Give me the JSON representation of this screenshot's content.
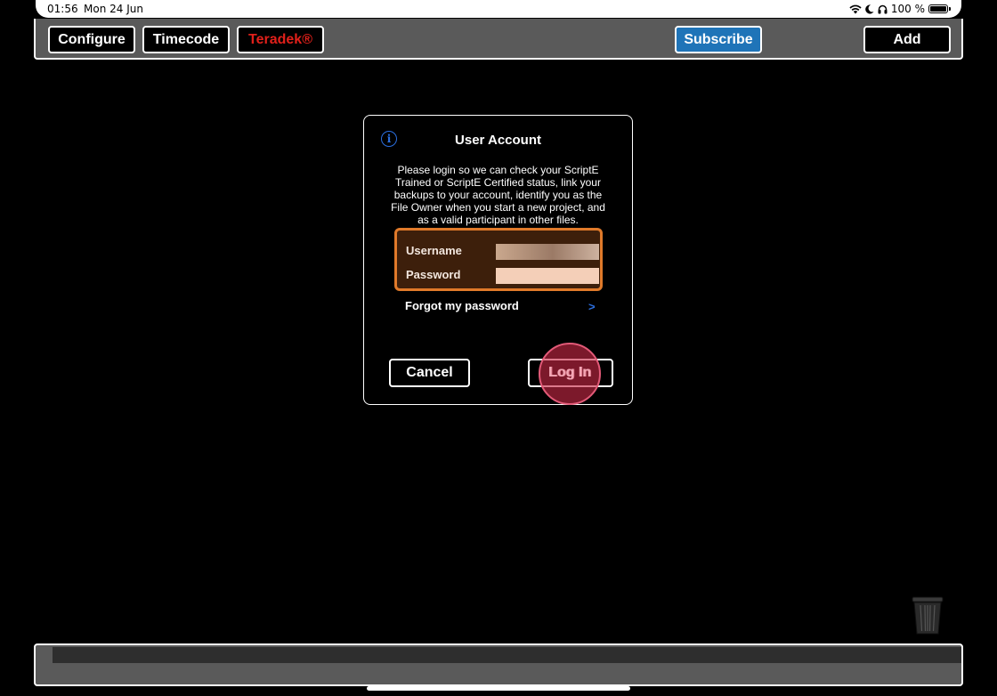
{
  "status_bar": {
    "time": "01:56",
    "date": "Mon 24 Jun",
    "battery": "100 %",
    "icons": [
      "wifi-icon",
      "moon-icon",
      "headphones-icon",
      "battery-icon"
    ]
  },
  "toolbar": {
    "configure": "Configure",
    "timecode": "Timecode",
    "teradek": "Teradek®",
    "subscribe": "Subscribe",
    "add": "Add"
  },
  "dialog": {
    "title": "User Account",
    "message": "Please login so we can check your ScriptE Trained or ScriptE Certified status, link your backups to your account, identify you as the File Owner when you start a new project, and as a valid participant in other files.",
    "username_label": "Username",
    "username_value": "",
    "password_label": "Password",
    "password_value": "",
    "forgot": "Forgot my password",
    "forgot_chevron": ">",
    "cancel": "Cancel",
    "login": "Log In",
    "info_glyph": "i"
  },
  "colors": {
    "toolbar_bg": "#5a5a5a",
    "subscribe_bg": "#1f74b8",
    "teradek_text": "#e0201a",
    "creds_border": "#e07a2a",
    "link_blue": "#2b6fe0",
    "tap_highlight": "#c82846"
  }
}
